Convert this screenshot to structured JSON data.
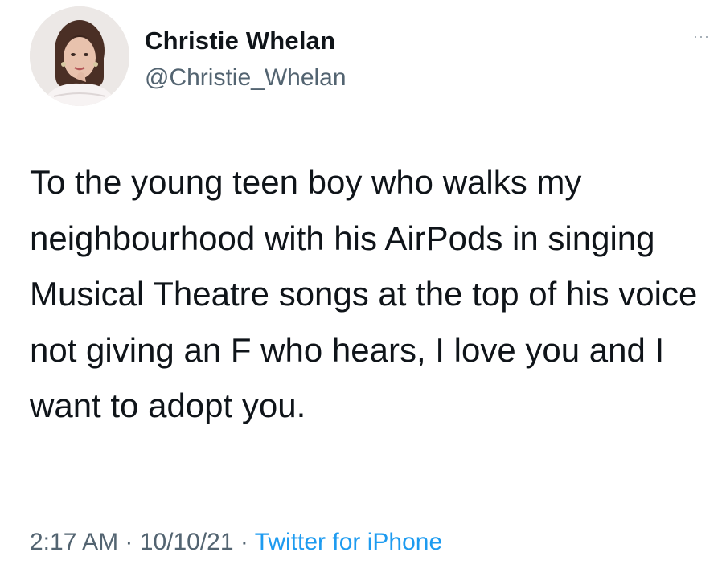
{
  "tweet": {
    "author": {
      "display_name": "Christie Whelan",
      "handle": "@Christie_Whelan",
      "avatar_icon": "profile-photo"
    },
    "more_icon": "ellipsis-icon",
    "more_label": "···",
    "text": "To the young teen boy who walks my neighbourhood with his AirPods in singing Musical Theatre songs at the top of his voice not giving an F who hears, I love you and I want to adopt you.",
    "time": "2:17 AM",
    "separator": "·",
    "date": "10/10/21",
    "source": "Twitter for iPhone"
  },
  "colors": {
    "text": "#0f1419",
    "secondary": "#536471",
    "link": "#1d9bf0",
    "background": "#ffffff"
  }
}
